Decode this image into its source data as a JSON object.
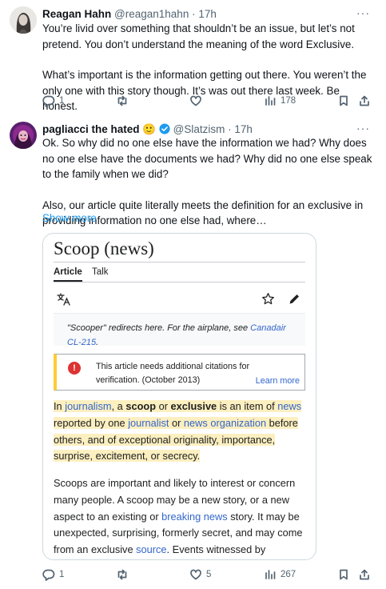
{
  "tweet1": {
    "name": "Reagan Hahn",
    "handle": "@reagan1hahn",
    "time": "· 17h",
    "more": "···",
    "paragraphs": [
      "You’re livid over something that shouldn’t be an issue, but let’s not pretend. You don’t understand the meaning of the word Exclusive.",
      "What’s important is the information getting out there. You weren’t the only one with this story though. It’s was out there last week. Be honest."
    ],
    "replies": "1",
    "retweets": "",
    "likes": "",
    "views": "178"
  },
  "tweet2": {
    "name": "pagliacci the hated",
    "emoji": "🙂",
    "handle": "@Slatzism",
    "time": "· 17h",
    "more": "···",
    "paragraphs": [
      "Ok. So why did no one else have the information we had? Why does no one else have the documents we had? Why did no one else speak to the family when we did?",
      "Also, our article quite literally meets the definition for an exclusive in providing information no one else had, where…"
    ],
    "show_more": "Show more",
    "replies": "1",
    "retweets": "",
    "likes": "5",
    "views": "267"
  },
  "wiki": {
    "title": "Scoop (news)",
    "tab_article": "Article",
    "tab_talk": "Talk",
    "hatnote_prefix": "\"Scooper\" redirects here. For the airplane, see ",
    "hatnote_link1": "Canadair",
    "hatnote_link2": "CL-215",
    "hatnote_suffix": ".",
    "notice_icon": "!",
    "notice_text": "This article needs additional citations for verification. (October 2013)",
    "notice_learn": "Learn more",
    "p1": {
      "t1": "In ",
      "l1": "journalism",
      "t2": ", a ",
      "b1": "scoop",
      "t3": " or ",
      "b2": "exclusive",
      "t4": " is an item of ",
      "l2": "news",
      "t5": " reported by one ",
      "l3": "journalist",
      "t6": " or ",
      "l4": "news organization",
      "t7": " before others, and of exceptional originality, importance, surprise, excitement, or secrecy."
    },
    "p2": {
      "t1": "Scoops are important and likely to interest or concern many people. A scoop may be a new story, or a new aspect to an existing or ",
      "l1": "breaking news",
      "t2": " story. It may be unexpected, surprising, formerly secret, and may come from an exclusive ",
      "l2": "source",
      "t3": ". Events witnessed by"
    }
  },
  "icons": [
    "reply-icon",
    "retweet-icon",
    "like-icon",
    "views-icon",
    "bookmark-icon",
    "share-icon",
    "translate-icon",
    "star-icon",
    "edit-icon",
    "verified-icon"
  ],
  "colors": {
    "accent": "#1d9bf0",
    "wiki_link": "#3366cc",
    "highlight": "#fcefc0",
    "notice_bar": "#ffcc33"
  }
}
